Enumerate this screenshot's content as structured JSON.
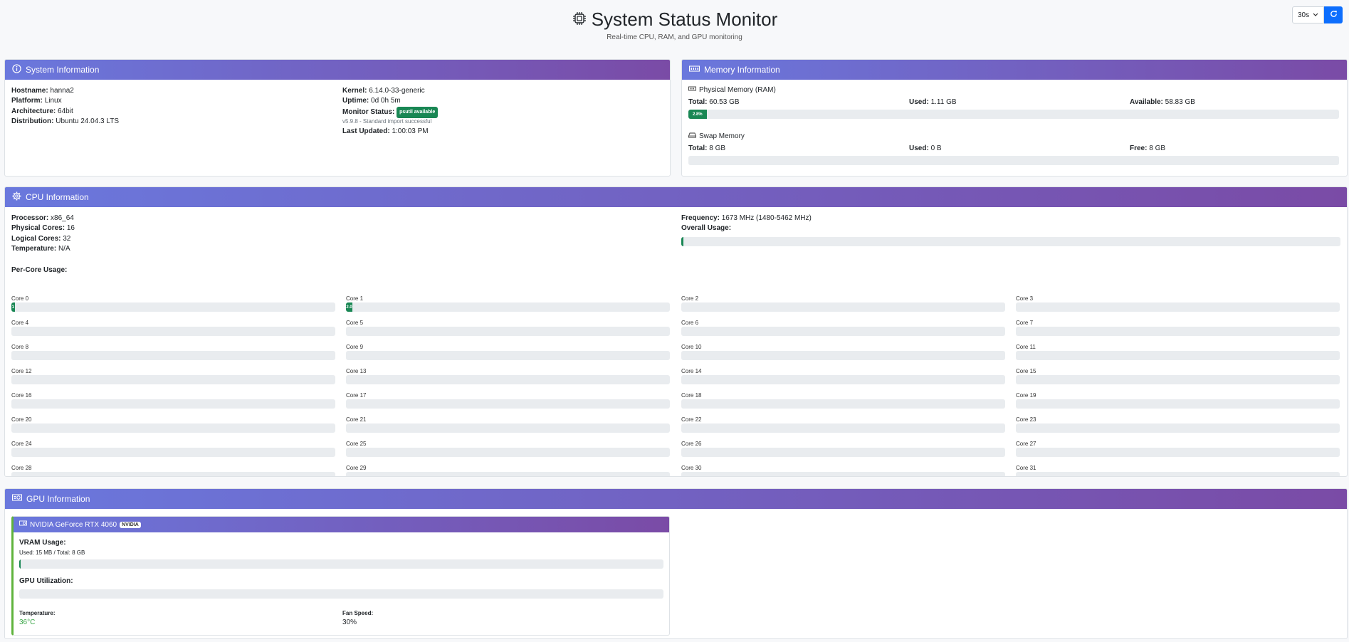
{
  "header": {
    "title": "System Status Monitor",
    "subtitle": "Real-time CPU, RAM, and GPU monitoring",
    "refresh_interval": "30s"
  },
  "system": {
    "title": "System Information",
    "hostname_label": "Hostname:",
    "hostname": "hanna2",
    "platform_label": "Platform:",
    "platform": "Linux",
    "arch_label": "Architecture:",
    "arch": "64bit",
    "distro_label": "Distribution:",
    "distro": "Ubuntu 24.04.3 LTS",
    "kernel_label": "Kernel:",
    "kernel": "6.14.0-33-generic",
    "uptime_label": "Uptime:",
    "uptime": "0d 0h 5m",
    "monitor_label": "Monitor Status:",
    "monitor_badge": "psutil available",
    "import_note": "v5.9.8 - Standard import successful",
    "updated_label": "Last Updated:",
    "updated": "1:00:03 PM"
  },
  "memory": {
    "title": "Memory Information",
    "ram_title": "Physical Memory (RAM)",
    "ram_total_label": "Total:",
    "ram_total": "60.53 GB",
    "ram_used_label": "Used:",
    "ram_used": "1.11 GB",
    "ram_avail_label": "Available:",
    "ram_avail": "58.83 GB",
    "ram_percent": 2.8,
    "ram_percent_text": "2.8%",
    "swap_title": "Swap Memory",
    "swap_total_label": "Total:",
    "swap_total": "8 GB",
    "swap_used_label": "Used:",
    "swap_used": "0 B",
    "swap_free_label": "Free:",
    "swap_free": "8 GB",
    "swap_percent": 0
  },
  "cpu": {
    "title": "CPU Information",
    "processor_label": "Processor:",
    "processor": "x86_64",
    "physical_label": "Physical Cores:",
    "physical": "16",
    "logical_label": "Logical Cores:",
    "logical": "32",
    "temp_label": "Temperature:",
    "temp": "N/A",
    "freq_label": "Frequency:",
    "freq": "1673 MHz (1480-5462 MHz)",
    "overall_label": "Overall Usage:",
    "overall_percent": 0.3,
    "per_core_label": "Per-Core Usage:",
    "cores": [
      {
        "label": "Core 0",
        "percent": 1.0,
        "text": "1"
      },
      {
        "label": "Core 1",
        "percent": 2.0,
        "text": "2.0"
      },
      {
        "label": "Core 2",
        "percent": 0,
        "text": ""
      },
      {
        "label": "Core 3",
        "percent": 0,
        "text": ""
      },
      {
        "label": "Core 4",
        "percent": 0,
        "text": ""
      },
      {
        "label": "Core 5",
        "percent": 0,
        "text": ""
      },
      {
        "label": "Core 6",
        "percent": 0,
        "text": ""
      },
      {
        "label": "Core 7",
        "percent": 0,
        "text": ""
      },
      {
        "label": "Core 8",
        "percent": 0,
        "text": ""
      },
      {
        "label": "Core 9",
        "percent": 0,
        "text": ""
      },
      {
        "label": "Core 10",
        "percent": 0,
        "text": ""
      },
      {
        "label": "Core 11",
        "percent": 0,
        "text": ""
      },
      {
        "label": "Core 12",
        "percent": 0,
        "text": ""
      },
      {
        "label": "Core 13",
        "percent": 0,
        "text": ""
      },
      {
        "label": "Core 14",
        "percent": 0,
        "text": ""
      },
      {
        "label": "Core 15",
        "percent": 0,
        "text": ""
      },
      {
        "label": "Core 16",
        "percent": 0,
        "text": ""
      },
      {
        "label": "Core 17",
        "percent": 0,
        "text": ""
      },
      {
        "label": "Core 18",
        "percent": 0,
        "text": ""
      },
      {
        "label": "Core 19",
        "percent": 0,
        "text": ""
      },
      {
        "label": "Core 20",
        "percent": 0,
        "text": ""
      },
      {
        "label": "Core 21",
        "percent": 0,
        "text": ""
      },
      {
        "label": "Core 22",
        "percent": 0,
        "text": ""
      },
      {
        "label": "Core 23",
        "percent": 0,
        "text": ""
      },
      {
        "label": "Core 24",
        "percent": 0,
        "text": ""
      },
      {
        "label": "Core 25",
        "percent": 0,
        "text": ""
      },
      {
        "label": "Core 26",
        "percent": 0,
        "text": ""
      },
      {
        "label": "Core 27",
        "percent": 0,
        "text": ""
      },
      {
        "label": "Core 28",
        "percent": 0,
        "text": ""
      },
      {
        "label": "Core 29",
        "percent": 0,
        "text": ""
      },
      {
        "label": "Core 30",
        "percent": 0,
        "text": ""
      },
      {
        "label": "Core 31",
        "percent": 0,
        "text": ""
      }
    ]
  },
  "gpu": {
    "title": "GPU Information",
    "name": "NVIDIA GeForce RTX 4060",
    "vendor_badge": "NVIDIA",
    "vram_label": "VRAM Usage:",
    "vram_detail": "Used: 15 MB / Total: 8 GB",
    "vram_percent": 0.2,
    "util_label": "GPU Utilization:",
    "util_percent": 0,
    "temp_label": "Temperature:",
    "temp": "36°C",
    "fan_label": "Fan Speed:",
    "fan": "30%",
    "accent_color": "#5fb33c",
    "temp_color": "#3aa648"
  },
  "colors": {
    "header_gradient_start": "#6a78dd",
    "header_gradient_end": "#7a4ba6",
    "progress_fill": "#198754",
    "refresh_button": "#0d6efd"
  }
}
